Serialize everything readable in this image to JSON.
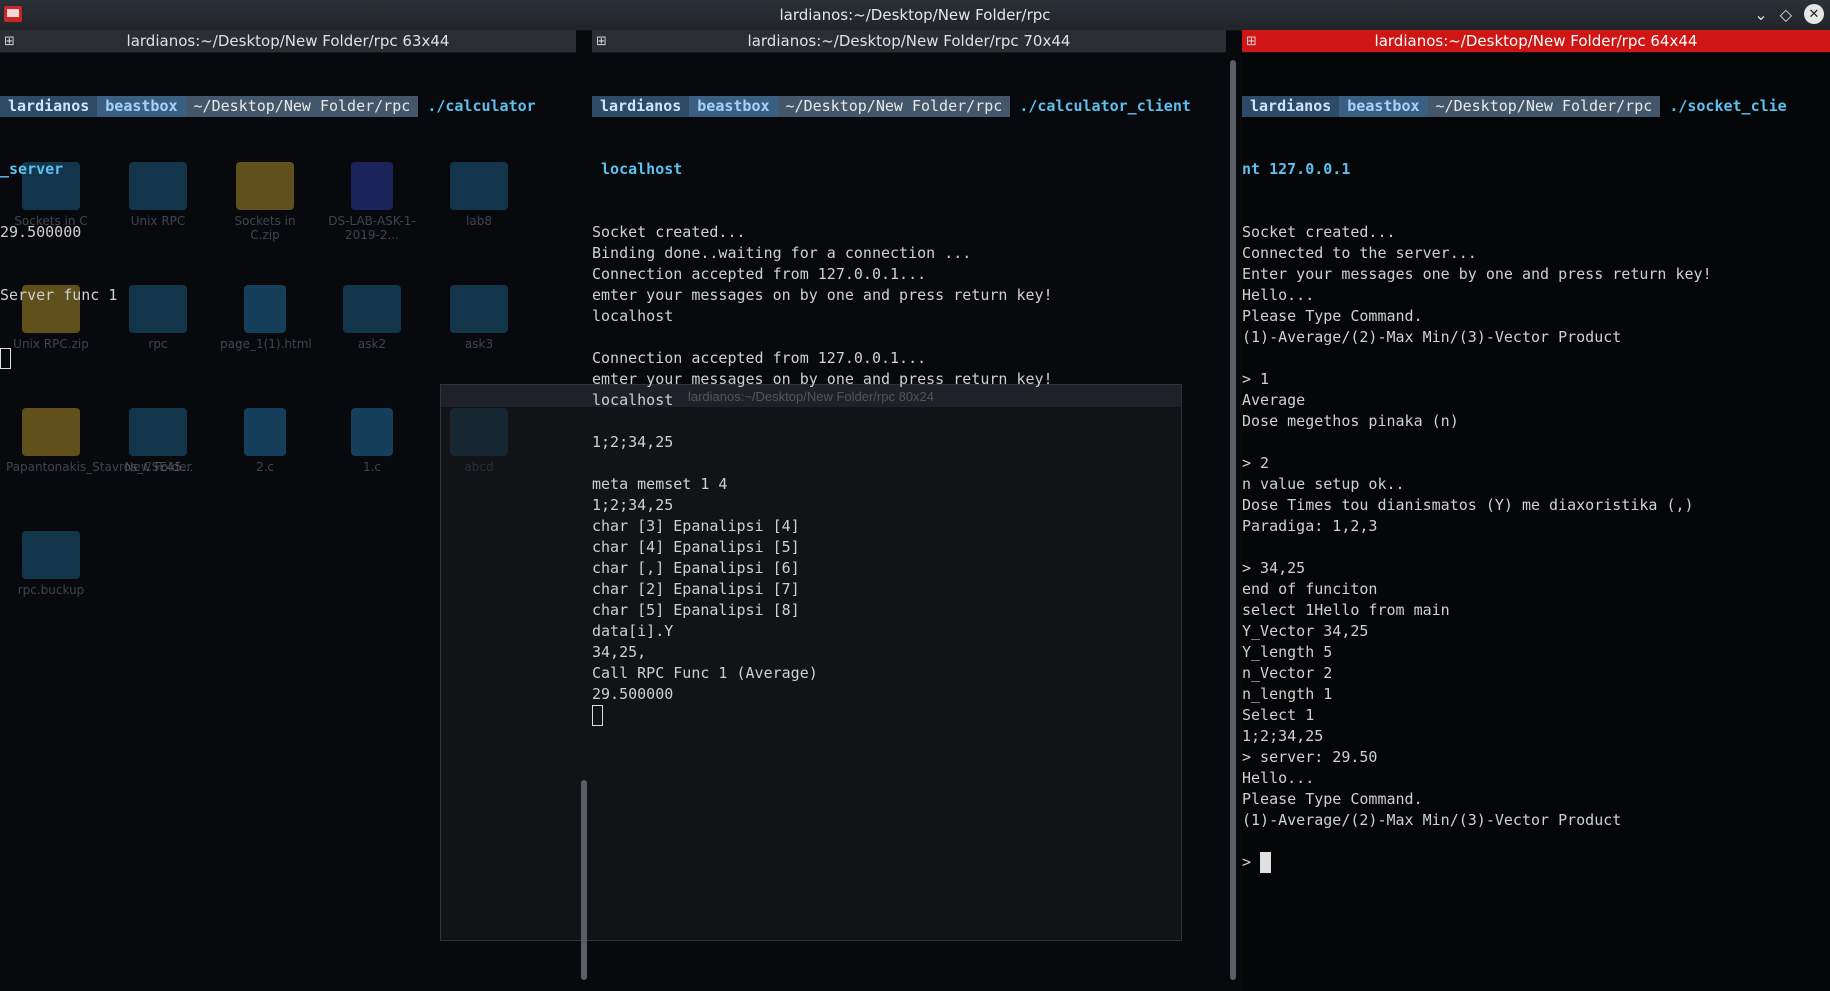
{
  "window": {
    "title": "lardianos:~/Desktop/New Folder/rpc"
  },
  "panes": [
    {
      "title": "lardianos:~/Desktop/New Folder/rpc 63x44",
      "prompt": {
        "user": "lardianos",
        "host": "beastbox",
        "dir": "~/Desktop/New Folder/rpc",
        "cmd": "./calculator",
        "cmd_wrap": "_server"
      },
      "lines": [
        "29.500000",
        "Server func 1"
      ]
    },
    {
      "title": "lardianos:~/Desktop/New Folder/rpc 70x44",
      "prompt": {
        "user": "lardianos",
        "host": "beastbox",
        "dir": "~/Desktop/New Folder/rpc",
        "cmd": "./calculator_client",
        "cmd_wrap": " localhost"
      },
      "lines": [
        "Socket created...",
        "Binding done..waiting for a connection ...",
        "Connection accepted from 127.0.0.1...",
        "emter your messages on by one and press return key!",
        "localhost",
        "",
        "Connection accepted from 127.0.0.1...",
        "emter your messages on by one and press return key!",
        "localhost",
        "",
        "1;2;34,25",
        "",
        "meta memset 1 4",
        "1;2;34,25",
        "char [3] Epanalipsi [4]",
        "char [4] Epanalipsi [5]",
        "char [,] Epanalipsi [6]",
        "char [2] Epanalipsi [7]",
        "char [5] Epanalipsi [8]",
        "data[i].Y",
        "34,25,",
        "Call RPC Func 1 (Average)",
        "29.500000"
      ]
    },
    {
      "title": "lardianos:~/Desktop/New Folder/rpc 64x44",
      "prompt": {
        "user": "lardianos",
        "host": "beastbox",
        "dir": "~/Desktop/New Folder/rpc",
        "cmd": "./socket_clie",
        "cmd_wrap": "nt 127.0.0.1"
      },
      "lines": [
        "Socket created...",
        "Connected to the server...",
        "Enter your messages one by one and press return key!",
        "Hello...",
        "Please Type Command.",
        "(1)-Average/(2)-Max Min/(3)-Vector Product",
        "",
        "> 1",
        "Average",
        "Dose megethos pinaka (n)",
        "",
        "> 2",
        "n value setup ok..",
        "Dose Times tou dianismatos (Y) me diaxoristika (,)",
        "Paradiga: 1,2,3",
        "",
        "> 34,25",
        "end of funciton",
        "select 1Hello from main",
        "Y_Vector 34,25",
        "Y_length 5",
        "n_Vector 2",
        "n_length 1",
        "Select 1",
        "1;2;34,25",
        "> server: 29.50",
        "Hello...",
        "Please Type Command.",
        "(1)-Average/(2)-Max Min/(3)-Vector Product",
        "",
        ">"
      ]
    }
  ],
  "desktop_icons": [
    {
      "label": "Sockets in C",
      "kind": "folder"
    },
    {
      "label": "Unix RPC",
      "kind": "folder"
    },
    {
      "label": "Sockets in C.zip",
      "kind": "zip"
    },
    {
      "label": "DS-LAB-ASK-1-2019-2...",
      "kind": "doc"
    },
    {
      "label": "lab8",
      "kind": "folder"
    },
    {
      "label": "Unix RPC.zip",
      "kind": "zip"
    },
    {
      "label": "rpc",
      "kind": "folder"
    },
    {
      "label": "page_1(1).html",
      "kind": "c"
    },
    {
      "label": "ask2",
      "kind": "folder"
    },
    {
      "label": "ask3",
      "kind": "folder"
    },
    {
      "label": "Papantonakis_Stavros_CSE45...",
      "kind": "zip"
    },
    {
      "label": "New Folder",
      "kind": "folder"
    },
    {
      "label": "2.c",
      "kind": "c"
    },
    {
      "label": "1.c",
      "kind": "c"
    },
    {
      "label": "abcd",
      "kind": "folder"
    },
    {
      "label": "rpc.buckup",
      "kind": "folder"
    }
  ],
  "ghost_window": {
    "title": "lardianos:~/Desktop/New Folder/rpc 80x24"
  }
}
